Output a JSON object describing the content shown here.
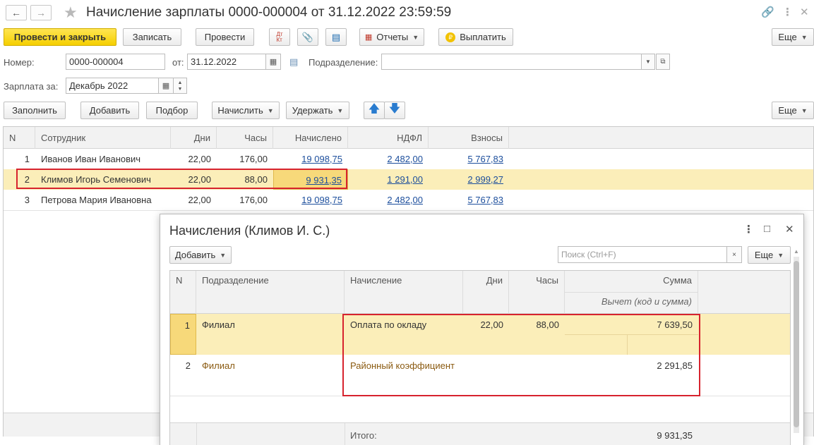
{
  "window": {
    "title": "Начисление зарплаты 0000-000004 от 31.12.2022 23:59:59"
  },
  "toolbar": {
    "post_close": "Провести и закрыть",
    "save": "Записать",
    "post": "Провести",
    "dtkt": "Дт Кт",
    "reports": "Отчеты",
    "pay": "Выплатить",
    "more": "Еще"
  },
  "form": {
    "number_label": "Номер:",
    "number_value": "0000-000004",
    "from_label": "от:",
    "date_value": "31.12.2022",
    "dept_label": "Подразделение:",
    "dept_value": "",
    "salary_for_label": "Зарплата за:",
    "salary_for_value": "Декабрь 2022"
  },
  "table_toolbar": {
    "fill": "Заполнить",
    "add": "Добавить",
    "select": "Подбор",
    "accrue": "Начислить",
    "deduct": "Удержать",
    "more": "Еще"
  },
  "main_table": {
    "headers": [
      "N",
      "Сотрудник",
      "Дни",
      "Часы",
      "Начислено",
      "НДФЛ",
      "Взносы"
    ],
    "rows": [
      {
        "n": "1",
        "employee": "Иванов Иван Иванович",
        "days": "22,00",
        "hours": "176,00",
        "accrued": "19 098,75",
        "ndfl": "2 482,00",
        "contrib": "5 767,83"
      },
      {
        "n": "2",
        "employee": "Климов Игорь Семенович",
        "days": "22,00",
        "hours": "88,00",
        "accrued": "9 931,35",
        "ndfl": "1 291,00",
        "contrib": "2 999,27"
      },
      {
        "n": "3",
        "employee": "Петрова Мария Ивановна",
        "days": "22,00",
        "hours": "176,00",
        "accrued": "19 098,75",
        "ndfl": "2 482,00",
        "contrib": "5 767,83"
      }
    ],
    "selected_row": 2
  },
  "dialog": {
    "title": "Начисления (Климов И. С.)",
    "add": "Добавить",
    "search_placeholder": "Поиск (Ctrl+F)",
    "more": "Еще",
    "headers": {
      "n": "N",
      "dept": "Подразделение",
      "accrual": "Начисление",
      "days": "Дни",
      "hours": "Часы",
      "sum": "Сумма",
      "deduction": "Вычет (код и сумма)"
    },
    "rows": [
      {
        "n": "1",
        "dept": "Филиал",
        "accrual": "Оплата по окладу",
        "days": "22,00",
        "hours": "88,00",
        "sum": "7 639,50"
      },
      {
        "n": "2",
        "dept": "Филиал",
        "accrual": "Районный коэффициент",
        "days": "",
        "hours": "",
        "sum": "2 291,85"
      }
    ],
    "total_label": "Итого:",
    "total_value": "9 931,35"
  }
}
